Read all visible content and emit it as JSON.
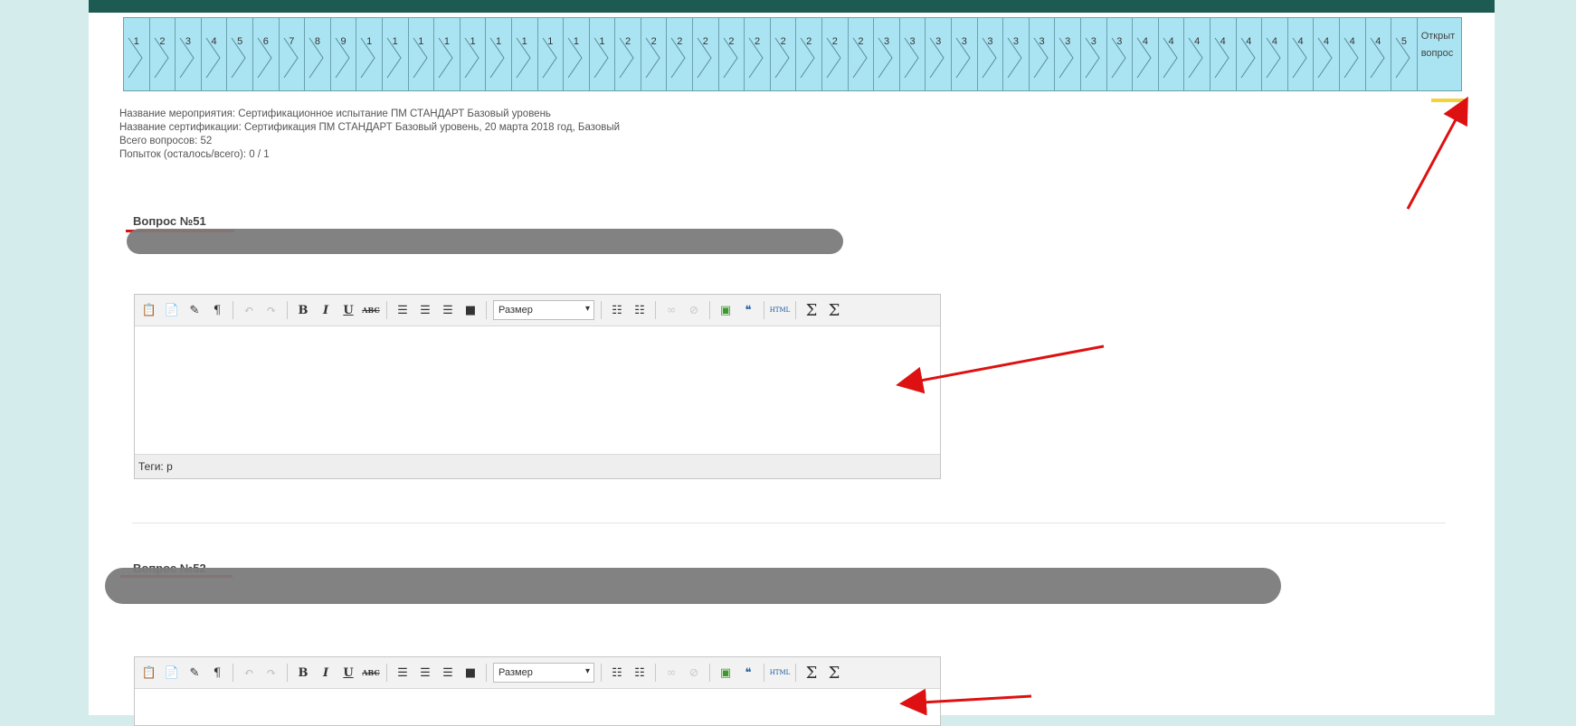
{
  "question_nav": {
    "tiles": [
      "1",
      "2",
      "3",
      "4",
      "5",
      "6",
      "7",
      "8",
      "9",
      "1",
      "1",
      "1",
      "1",
      "1",
      "1",
      "1",
      "1",
      "1",
      "1",
      "2",
      "2",
      "2",
      "2",
      "2",
      "2",
      "2",
      "2",
      "2",
      "2",
      "3",
      "3",
      "3",
      "3",
      "3",
      "3",
      "3",
      "3",
      "3",
      "3",
      "4",
      "4",
      "4",
      "4",
      "4",
      "4",
      "4",
      "4",
      "4",
      "4",
      "5"
    ],
    "open_questions_label": [
      "Открыт",
      "вопрос"
    ]
  },
  "info": {
    "event_name": "Название мероприятия: Сертификационное испытание ПМ СТАНДАРТ Базовый уровень",
    "certification_name": "Название сертификации: Сертификация ПМ СТАНДАРТ Базовый уровень, 20 марта 2018 год, Базовый",
    "total_questions": "Всего вопросов: 52",
    "attempts": "Попыток (осталось/всего): 0 / 1"
  },
  "questions": [
    {
      "title": "Вопрос №51",
      "tags": "Теги: p"
    },
    {
      "title": "Вопрос №52"
    }
  ],
  "toolbar": {
    "bold": "B",
    "italic": "I",
    "underline": "U",
    "strike": "ABC",
    "paragraph": "¶",
    "size_label": "Размер",
    "caret": "▾",
    "html": "HTML",
    "quote": "❝",
    "sigma1": "Σ",
    "sigma2": "Σ"
  },
  "colors": {
    "topbar": "#1c5a52",
    "tile_bg": "#aae4f2",
    "annotation_red": "#dd1111",
    "highlight_yellow": "#f3d23a"
  }
}
